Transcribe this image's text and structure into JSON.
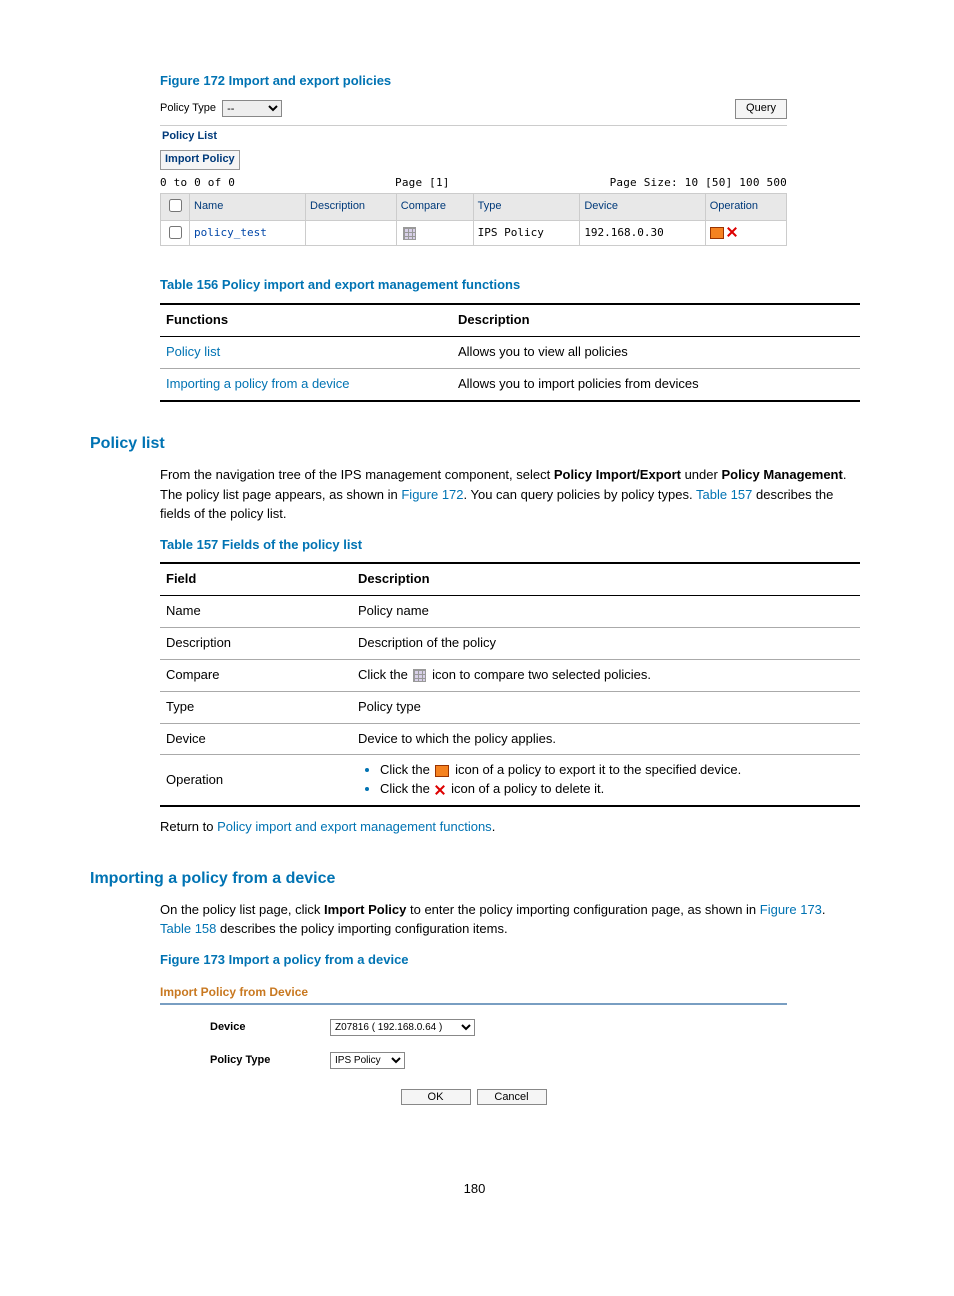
{
  "figure172": {
    "caption": "Figure 172 Import and export policies",
    "policyTypeLabel": "Policy Type",
    "policyTypeValue": "--",
    "queryBtn": "Query",
    "panelTitle": "Policy List",
    "importBtn": "Import Policy",
    "pager": {
      "range": "0 to 0 of 0",
      "page": "Page [1]",
      "size": "Page Size: 10 [50] 100 500"
    },
    "cols": [
      "Name",
      "Description",
      "Compare",
      "Type",
      "Device",
      "Operation"
    ],
    "row": {
      "name": "policy_test",
      "desc": "",
      "type": "IPS Policy",
      "device": "192.168.0.30"
    }
  },
  "table156": {
    "caption": "Table 156 Policy import and export management functions",
    "headers": [
      "Functions",
      "Description"
    ],
    "rows": [
      {
        "f": "Policy list",
        "d": "Allows you to view all policies"
      },
      {
        "f": "Importing a policy from a device",
        "d": "Allows you to import policies from devices"
      }
    ]
  },
  "policyList": {
    "heading": "Policy list",
    "p1a": "From the navigation tree of the IPS management component, select ",
    "p1b": "Policy Import/Export",
    "p1c": " under ",
    "p1d": "Policy Management",
    "p1e": ". The policy list page appears, as shown in ",
    "fig172": "Figure 172",
    "p1f": ". You can query policies by policy types. ",
    "t157": "Table 157",
    "p1g": " describes the fields of the policy list."
  },
  "table157": {
    "caption": "Table 157 Fields of the policy list",
    "headers": [
      "Field",
      "Description"
    ],
    "rows": [
      {
        "f": "Name",
        "d": "Policy name"
      },
      {
        "f": "Description",
        "d": "Description of the policy"
      },
      {
        "f": "Compare",
        "d_pre": "Click the ",
        "d_post": " icon to compare two selected policies."
      },
      {
        "f": "Type",
        "d": "Policy type"
      },
      {
        "f": "Device",
        "d": "Device to which the policy applies."
      },
      {
        "f": "Operation",
        "li1_pre": "Click the ",
        "li1_post": " icon of a policy to export it to the specified device.",
        "li2_pre": "Click the ",
        "li2_post": " icon of a policy to delete it."
      }
    ]
  },
  "returnLine": {
    "pre": "Return to ",
    "link": "Policy import and export management functions",
    "post": "."
  },
  "importing": {
    "heading": "Importing a policy from a device",
    "p1a": "On the policy list page, click ",
    "p1b": "Import Policy",
    "p1c": " to enter the policy importing configuration page, as shown in ",
    "fig173": "Figure 173",
    "p1d": ". ",
    "t158": "Table 158",
    "p1e": " describes the policy importing configuration items."
  },
  "figure173": {
    "caption": "Figure 173 Import a policy from a device",
    "hdr": "Import Policy from Device",
    "deviceLabel": "Device",
    "deviceValue": "Z07816 ( 192.168.0.64 )",
    "typeLabel": "Policy Type",
    "typeValue": "IPS Policy",
    "ok": "OK",
    "cancel": "Cancel"
  },
  "pageNum": "180"
}
